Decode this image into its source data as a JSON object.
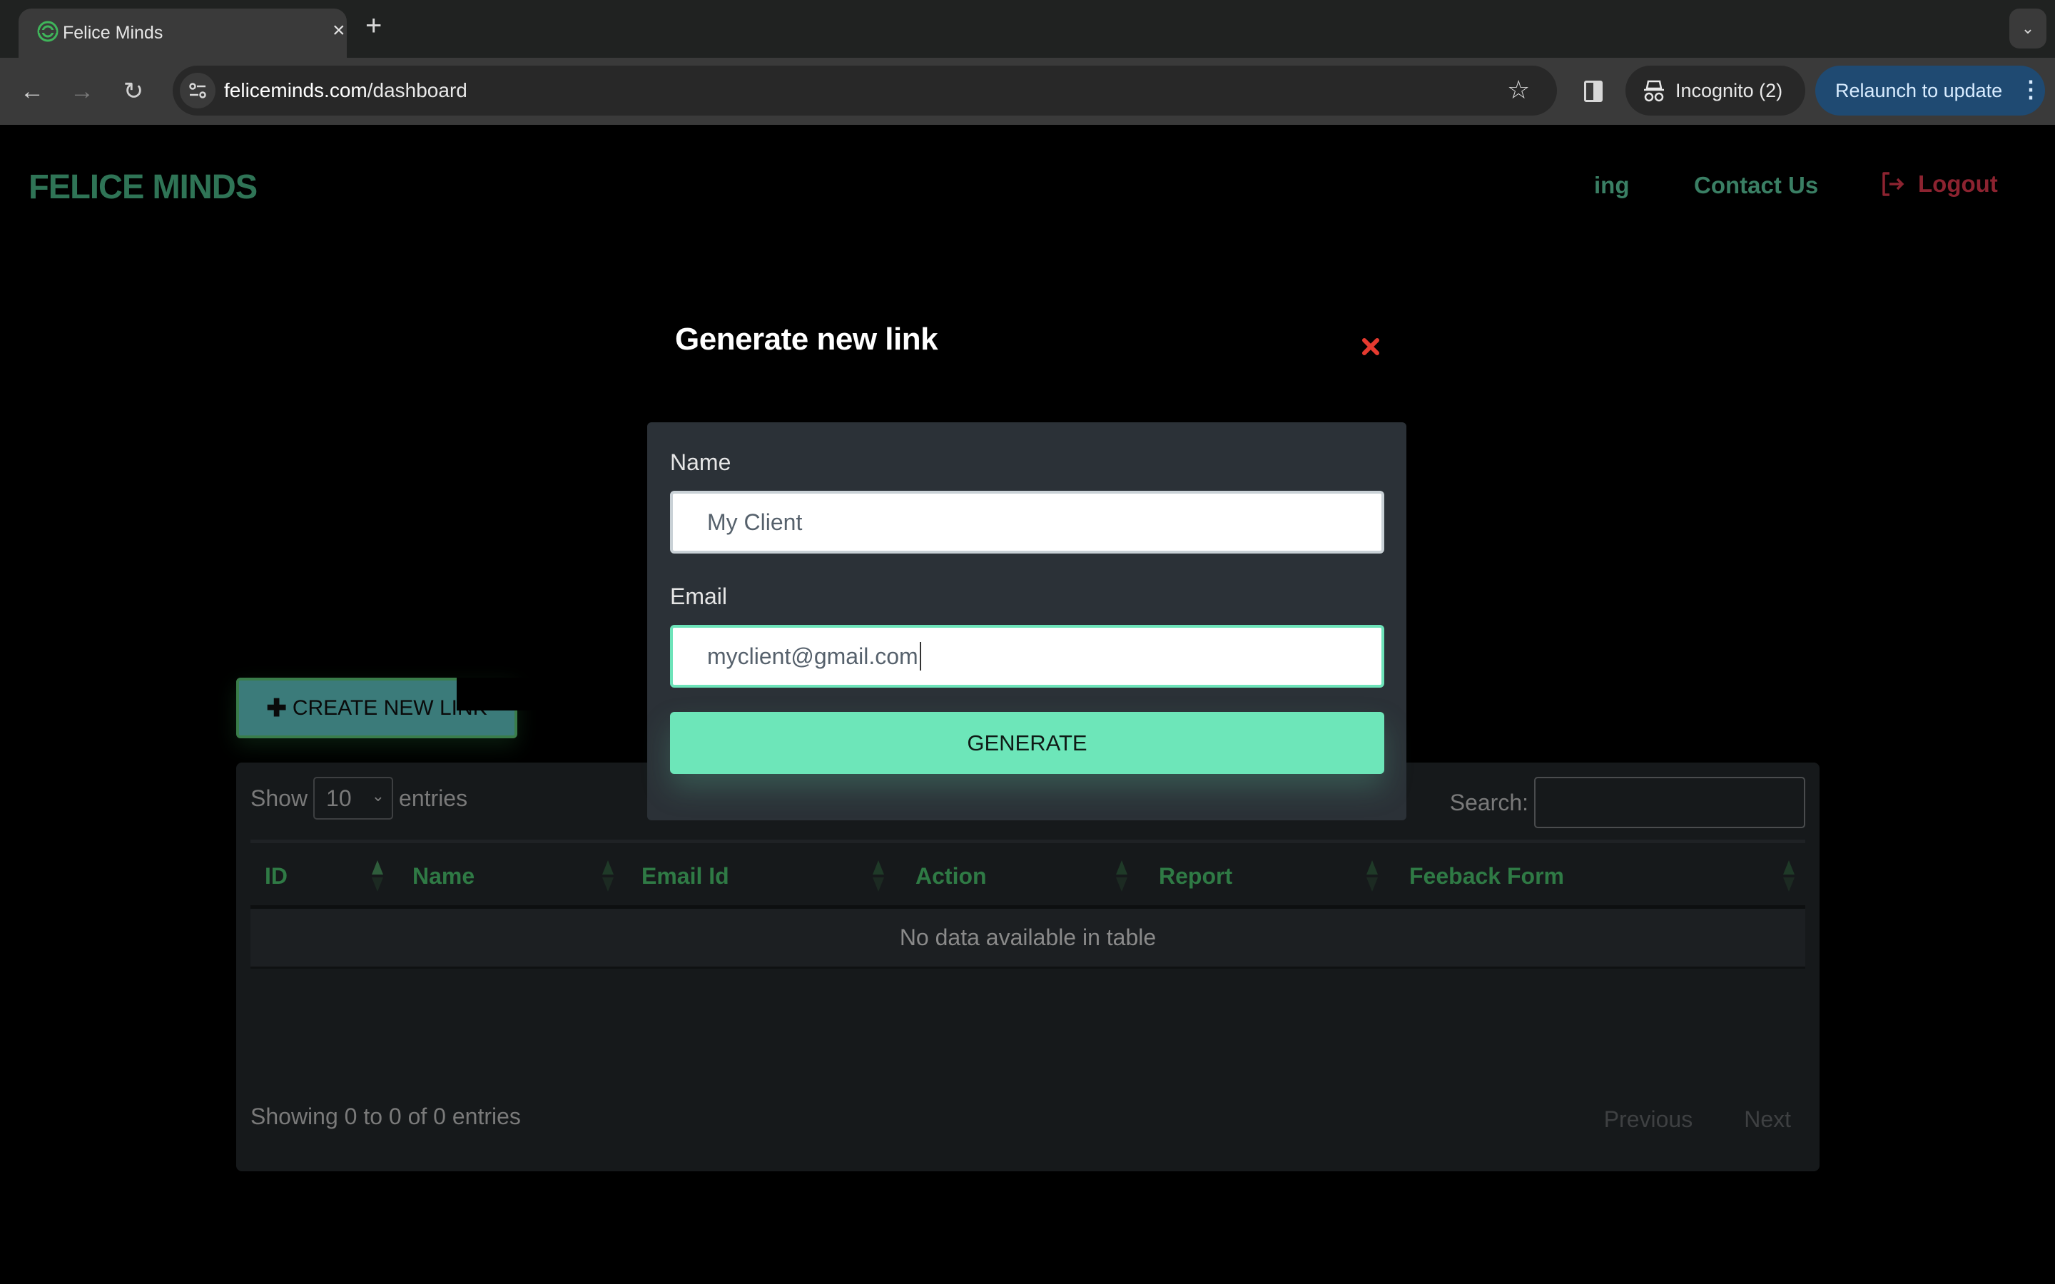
{
  "browser": {
    "tab_title": "Felice Minds",
    "url_host": "feliceminds.com",
    "url_path": "/dashboard",
    "incognito_label": "Incognito (2)",
    "relaunch_label": "Relaunch to update",
    "icons": [
      "back-arrow-icon",
      "forward-arrow-icon",
      "reload-icon",
      "site-settings-icon",
      "star-icon",
      "side-panel-icon",
      "incognito-icon",
      "kebab-menu-icon",
      "tab-close-icon",
      "new-tab-icon",
      "tab-list-icon"
    ]
  },
  "header": {
    "logo": "FELICE MINDS",
    "nav_partial": "ing",
    "nav_contact": "Contact Us",
    "logout": "Logout"
  },
  "modal": {
    "title": "Generate new link",
    "name_label": "Name",
    "name_value": "My Client",
    "email_label": "Email",
    "email_value": "myclient@gmail.com",
    "generate_label": "GENERATE"
  },
  "main": {
    "create_label": "CREATE NEW LINK",
    "show_label": "Show",
    "entries_label": "entries",
    "page_length": "10",
    "search_label": "Search:",
    "search_value": "",
    "columns": [
      "ID",
      "Name",
      "Email Id",
      "Action",
      "Report",
      "Feeback Form"
    ],
    "empty_message": "No data available in table",
    "info": "Showing 0 to 0 of 0 entries",
    "previous_label": "Previous",
    "next_label": "Next"
  },
  "colors": {
    "brand_green": "#2f7456",
    "accent_mint": "#6de6b9",
    "logout_red": "#8c2330",
    "close_red": "#e53a2f",
    "relaunch_blue": "#1f4a72"
  }
}
